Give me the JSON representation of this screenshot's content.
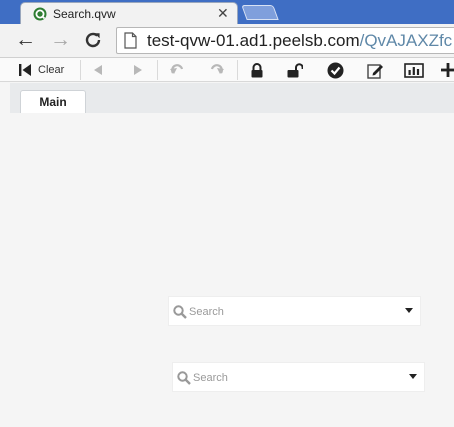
{
  "browser": {
    "tab": {
      "title": "Search.qvw",
      "close": "✕",
      "favicon_icon": "qlikview-icon"
    },
    "newtab_icon": "new-tab-icon",
    "nav": {
      "back": "←",
      "forward": "→",
      "reload": "C"
    },
    "address": {
      "host": "test-qvw-01.ad1.peelsb.com",
      "path": "/QvAJAXZfc"
    }
  },
  "toolbar": {
    "clear_label": "Clear",
    "icons": [
      "clear-icon",
      "back-icon",
      "forward-icon",
      "undo-icon",
      "redo-icon",
      "lock-icon",
      "unlock-icon",
      "approve-icon",
      "edit-icon",
      "chart-icon",
      "add-icon"
    ]
  },
  "sheets": {
    "tabs": [
      {
        "label": "Main"
      }
    ]
  },
  "listboxes": [
    {
      "placeholder": "Search"
    },
    {
      "placeholder": "Search"
    }
  ],
  "colors": {
    "tabstrip": "#3f6ec4",
    "url_path": "#5f88a8",
    "sheet_bg": "#f5f5f5"
  }
}
